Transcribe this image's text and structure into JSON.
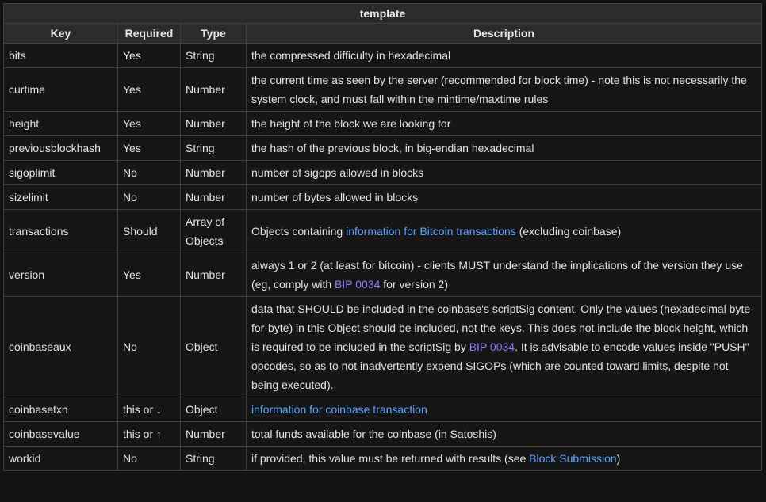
{
  "table": {
    "title": "template",
    "headers": {
      "key": "Key",
      "required": "Required",
      "type": "Type",
      "description": "Description"
    },
    "rows": [
      {
        "key": "bits",
        "required": "Yes",
        "type": "String",
        "desc": [
          {
            "text": "the compressed difficulty in hexadecimal"
          }
        ]
      },
      {
        "key": "curtime",
        "required": "Yes",
        "type": "Number",
        "desc": [
          {
            "text": "the current time as seen by the server (recommended for block time) - note this is not necessarily the system clock, and must fall within the mintime/maxtime rules"
          }
        ]
      },
      {
        "key": "height",
        "required": "Yes",
        "type": "Number",
        "desc": [
          {
            "text": "the height of the block we are looking for"
          }
        ]
      },
      {
        "key": "previousblockhash",
        "required": "Yes",
        "type": "String",
        "desc": [
          {
            "text": "the hash of the previous block, in big-endian hexadecimal"
          }
        ]
      },
      {
        "key": "sigoplimit",
        "required": "No",
        "type": "Number",
        "desc": [
          {
            "text": "number of sigops allowed in blocks"
          }
        ]
      },
      {
        "key": "sizelimit",
        "required": "No",
        "type": "Number",
        "desc": [
          {
            "text": "number of bytes allowed in blocks"
          }
        ]
      },
      {
        "key": "transactions",
        "required": "Should",
        "type": "Array of Objects",
        "desc": [
          {
            "text": "Objects containing "
          },
          {
            "text": "information for Bitcoin transactions",
            "link": true
          },
          {
            "text": " (excluding coinbase)"
          }
        ]
      },
      {
        "key": "version",
        "required": "Yes",
        "type": "Number",
        "desc": [
          {
            "text": "always 1 or 2 (at least for bitcoin) - clients MUST understand the implications of the version they use (eg, comply with "
          },
          {
            "text": "BIP 0034",
            "link": true,
            "visited": true
          },
          {
            "text": " for version 2)"
          }
        ]
      },
      {
        "key": "coinbaseaux",
        "required": "No",
        "type": "Object",
        "desc": [
          {
            "text": "data that SHOULD be included in the coinbase's scriptSig content. Only the values (hexadecimal byte-for-byte) in this Object should be included, not the keys. This does not include the block height, which is required to be included in the scriptSig by "
          },
          {
            "text": "BIP 0034",
            "link": true,
            "visited": true
          },
          {
            "text": ". It is advisable to encode values inside \"PUSH\" opcodes, so as to not inadvertently expend SIGOPs (which are counted toward limits, despite not being executed)."
          }
        ]
      },
      {
        "key": "coinbasetxn",
        "required": "this or ↓",
        "type": "Object",
        "desc": [
          {
            "text": "information for coinbase transaction",
            "link": true
          }
        ]
      },
      {
        "key": "coinbasevalue",
        "required": "this or ↑",
        "type": "Number",
        "desc": [
          {
            "text": "total funds available for the coinbase (in Satoshis)"
          }
        ]
      },
      {
        "key": "workid",
        "required": "No",
        "type": "String",
        "desc": [
          {
            "text": "if provided, this value must be returned with results (see "
          },
          {
            "text": "Block Submission",
            "link": true
          },
          {
            "text": ")"
          }
        ]
      }
    ]
  },
  "colors": {
    "background": "#121212",
    "header_background": "#2b2b2b",
    "border": "#3f3f3f",
    "link": "#58a6ff",
    "link_visited": "#8e7bff"
  }
}
